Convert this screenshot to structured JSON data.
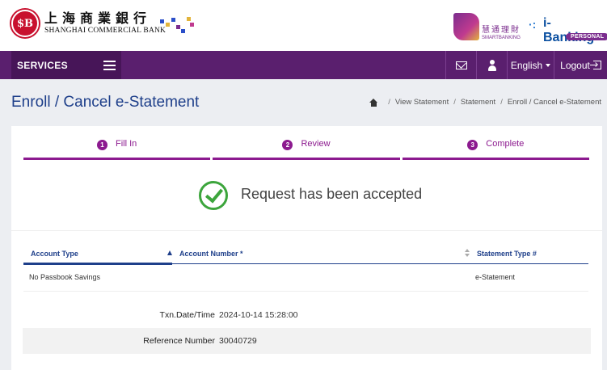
{
  "header": {
    "bank_seal": "$B",
    "bank_name_cn": "上海商業銀行",
    "bank_name_en": "SHANGHAI COMMERCIAL BANK",
    "smart_cn": "慧通理財",
    "smart_en": "SMARTBANKING",
    "ibanking_title": "i-Banking",
    "ibanking_badge": "PERSONAL"
  },
  "nav": {
    "services": "SERVICES",
    "language": "English",
    "logout": "Logout"
  },
  "page": {
    "title": "Enroll / Cancel e-Statement",
    "breadcrumb": [
      "View Statement",
      "Statement",
      "Enroll / Cancel e-Statement"
    ]
  },
  "steps": [
    {
      "num": "1",
      "label": "Fill In"
    },
    {
      "num": "2",
      "label": "Review"
    },
    {
      "num": "3",
      "label": "Complete"
    }
  ],
  "result": {
    "message": "Request has been accepted"
  },
  "table": {
    "headers": {
      "account_type": "Account Type",
      "account_number": "Account Number *",
      "statement_type": "Statement Type #"
    },
    "rows": [
      {
        "account_type": "No Passbook Savings",
        "account_number": "",
        "statement_type": "e-Statement"
      }
    ]
  },
  "details": [
    {
      "label": "Txn.Date/Time",
      "value": "2024-10-14 15:28:00"
    },
    {
      "label": "Reference Number",
      "value": "30040729"
    }
  ],
  "colors": {
    "brand_purple": "#5a1f6e",
    "step_purple": "#8c1a8f",
    "title_blue": "#1e3f8a",
    "success_green": "#3ca53c",
    "bank_red": "#c8102e"
  }
}
